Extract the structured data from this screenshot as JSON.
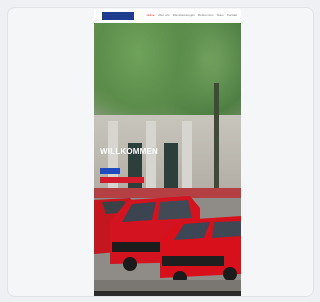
{
  "site": {
    "logo_label": "",
    "menu": [
      "Home",
      "Über uns",
      "Dienstleistungen",
      "Referenzen",
      "Team",
      "Kontakt"
    ],
    "active_menu_index": 0
  },
  "hero": {
    "title": "WILLKOMMEN",
    "subtitle": "",
    "primary_button": "",
    "secondary_button": ""
  },
  "footer": {
    "text": ""
  },
  "colors": {
    "brand_blue": "#1f4bbf",
    "brand_red": "#d21b2b",
    "nav_bg": "#ffffff",
    "footer_bg": "#2a2a2a"
  }
}
